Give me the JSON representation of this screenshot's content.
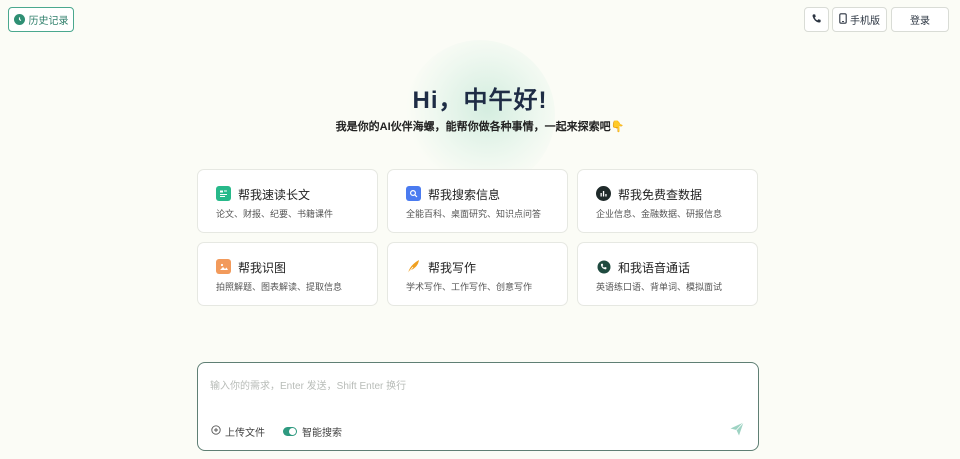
{
  "header": {
    "history_label": "历史记录",
    "mobile_label": "手机版",
    "login_label": "登录"
  },
  "hero": {
    "title": "Hi，中午好!",
    "subtitle": "我是你的AI伙伴海螺，能帮你做各种事情，一起来探索吧👇"
  },
  "cards": [
    {
      "title": "帮我速读长文",
      "desc": "论文、财报、纪要、书籍课件",
      "icon": "document-read-icon",
      "color": "#27b98a"
    },
    {
      "title": "帮我搜索信息",
      "desc": "全能百科、桌面研究、知识点问答",
      "icon": "search-info-icon",
      "color": "#4a7bf0"
    },
    {
      "title": "帮我免费查数据",
      "desc": "企业信息、金融数据、研报信息",
      "icon": "data-chart-icon",
      "color": "#1f2a2a"
    },
    {
      "title": "帮我识图",
      "desc": "拍照解题、图表解读、提取信息",
      "icon": "image-icon",
      "color": "#f29a5b"
    },
    {
      "title": "帮我写作",
      "desc": "学术写作、工作写作、创意写作",
      "icon": "quill-icon",
      "color": "#f0a020"
    },
    {
      "title": "和我语音通话",
      "desc": "英语练口语、背单词、模拟面试",
      "icon": "voice-call-icon",
      "color": "#1f4a3f"
    }
  ],
  "composer": {
    "placeholder": "输入你的需求，Enter 发送，Shift Enter 换行",
    "upload_label": "上传文件",
    "smart_search_label": "智能搜索",
    "smart_search_on": true
  }
}
